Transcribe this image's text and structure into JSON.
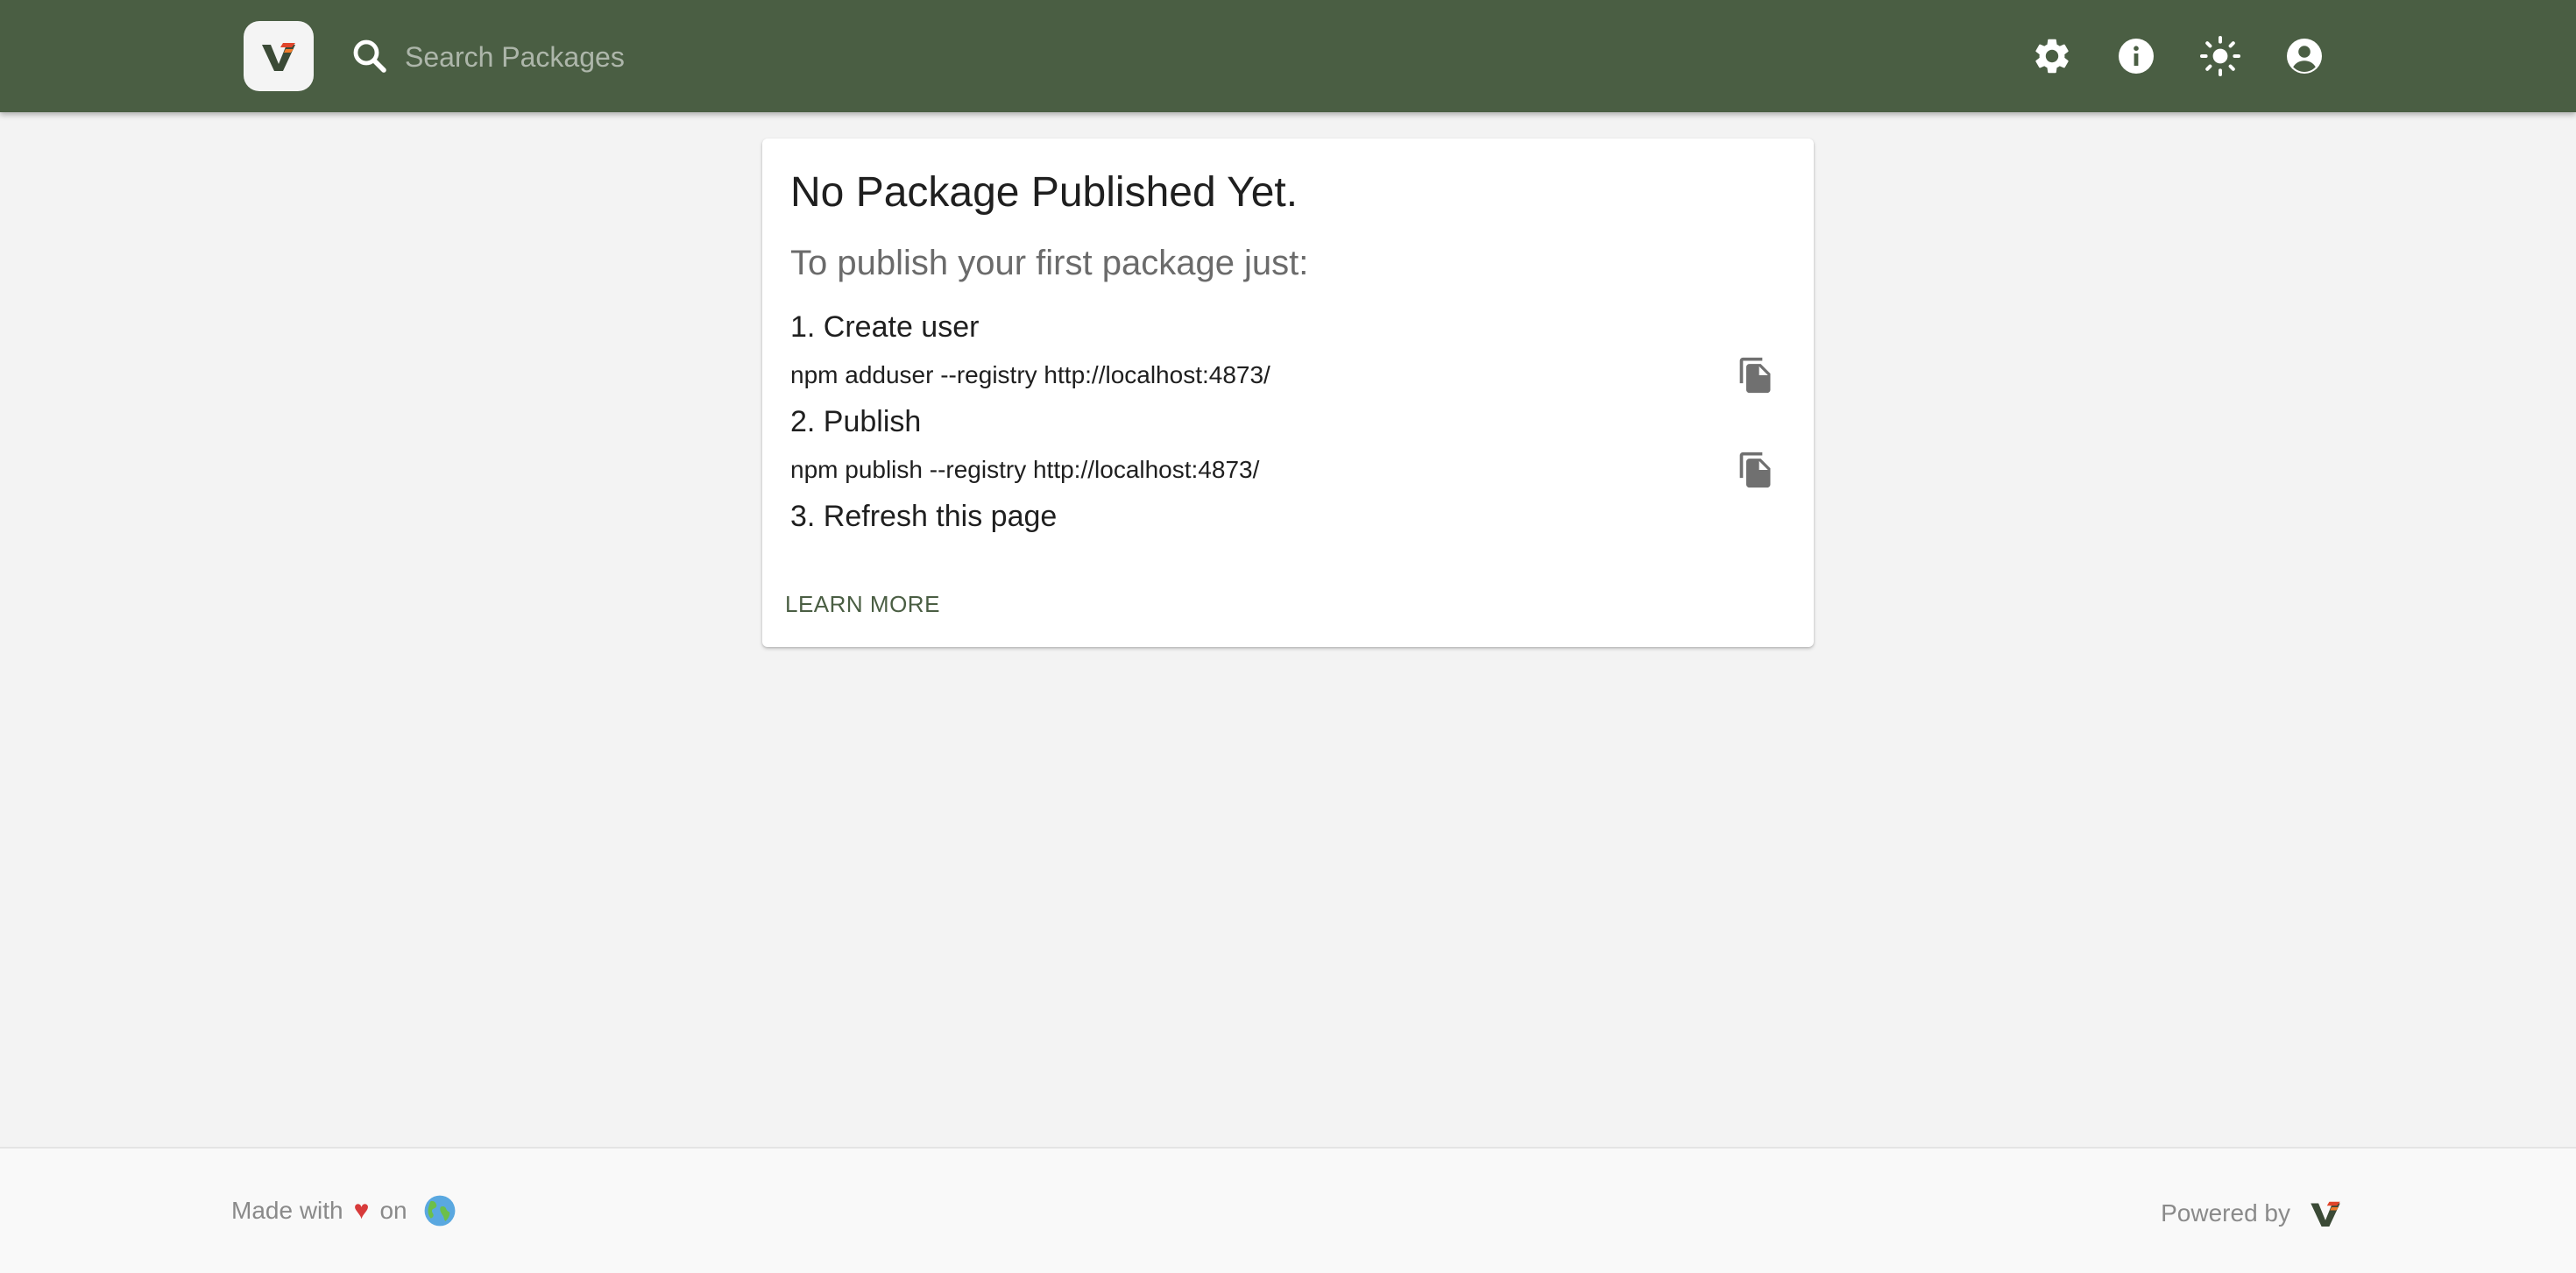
{
  "header": {
    "search_placeholder": "Search Packages",
    "brand_color": "#4a5e43",
    "icons": [
      "settings-icon",
      "info-icon",
      "theme-toggle-icon",
      "account-icon"
    ]
  },
  "card": {
    "title": "No Package Published Yet.",
    "subtitle": "To publish your first package just:",
    "steps": [
      {
        "label": "1. Create user",
        "command": "npm adduser --registry http://localhost:4873/"
      },
      {
        "label": "2. Publish",
        "command": "npm publish --registry http://localhost:4873/"
      },
      {
        "label": "3. Refresh this page"
      }
    ],
    "learn_more": "LEARN MORE"
  },
  "footer": {
    "made_with": "Made with",
    "heart": "♥",
    "on": "on",
    "powered_by": "Powered by"
  }
}
